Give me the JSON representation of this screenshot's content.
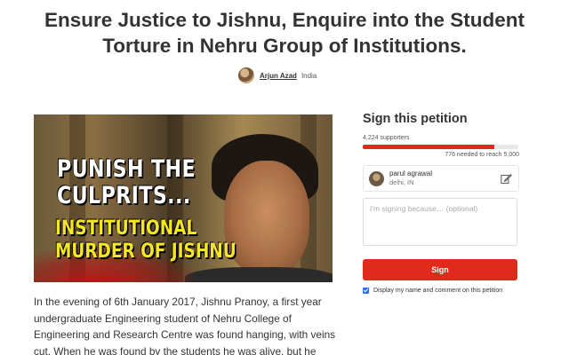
{
  "petition": {
    "title_line1": "Ensure Justice to Jishnu, Enquire into the Student",
    "title_line2": "Torture in Nehru Group of Institutions.",
    "author_name": "Arjun Azad",
    "author_location": "India"
  },
  "image": {
    "line1": "PUNISH THE",
    "line2": "CULPRITS...",
    "line3": "INSTITUTIONAL",
    "line4": "MURDER OF JISHNU"
  },
  "description": {
    "text": "In the evening of 6th January 2017, Jishnu Pranoy, a first year undergraduate Engineering student of Nehru College of Engineering and Research Centre was found hanging, with veins cut. When he was found by the students he was alive, but he"
  },
  "sign": {
    "title": "Sign this petition",
    "supporters": "4,224 supporters",
    "progress_fraction": 0.8448,
    "needed": "776 needed to reach 5,000",
    "user_name": "parul agrawal",
    "user_location": "delhi, IN",
    "comment_placeholder": "I'm signing because… (optional)",
    "button_label": "Sign",
    "display_label": "Display my name and comment on this petition"
  },
  "colors": {
    "accent": "#e02a1b",
    "checkbox": "#2f6ef0"
  },
  "icons": {
    "edit": "pencil-edit-icon"
  }
}
